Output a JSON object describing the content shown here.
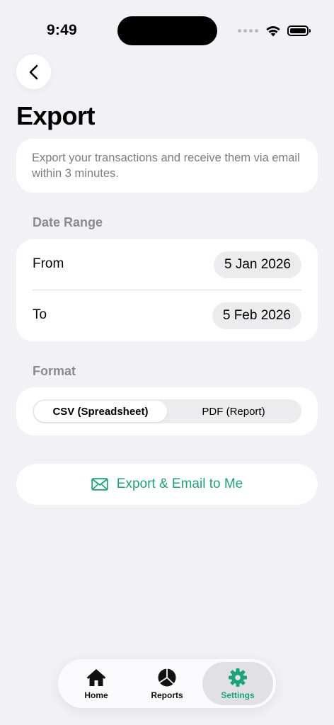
{
  "status": {
    "time": "9:49"
  },
  "header": {
    "title": "Export"
  },
  "description": "Export your transactions and receive them via email within 3 minutes.",
  "date_range": {
    "label": "Date Range",
    "from_label": "From",
    "from_value": "5 Jan 2026",
    "to_label": "To",
    "to_value": "5 Feb 2026"
  },
  "format": {
    "label": "Format",
    "options": [
      "CSV (Spreadsheet)",
      "PDF (Report)"
    ],
    "selected": "CSV (Spreadsheet)"
  },
  "export_button": {
    "label": "Export & Email to Me",
    "icon": "envelope-icon"
  },
  "tabbar": {
    "items": [
      {
        "label": "Home",
        "icon": "house-icon"
      },
      {
        "label": "Reports",
        "icon": "pie-chart-icon"
      },
      {
        "label": "Settings",
        "icon": "gear-icon"
      }
    ],
    "active": "Settings"
  },
  "colors": {
    "accent": "#1aa37a",
    "background": "#f2f1f6"
  }
}
